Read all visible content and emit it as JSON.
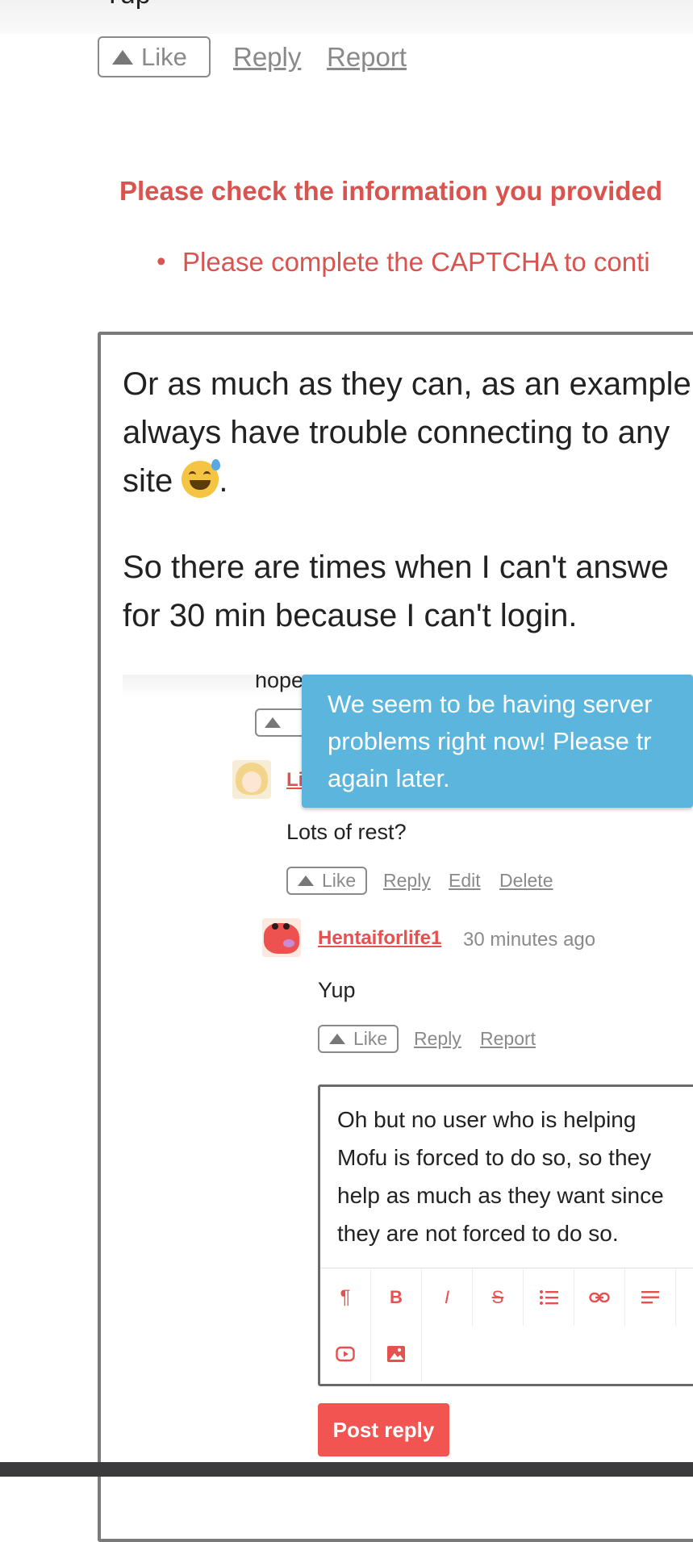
{
  "prev_comment": {
    "cut_text": "Yup",
    "like_label": "Like",
    "reply_label": "Reply",
    "report_label": "Report"
  },
  "error": {
    "title": "Please check the information you provided",
    "items": [
      "Please complete the CAPTCHA to conti"
    ]
  },
  "editor": {
    "paragraphs": [
      [
        "Or as much as they can, as an example",
        "always have trouble connecting to any",
        "site"
      ],
      [
        "So there are times when I can't answe",
        "for 30 min because I can't login."
      ]
    ],
    "emoji": "sweat-smile-emoji"
  },
  "embed": {
    "cut_text": "hope",
    "toast": [
      "We seem to be having server",
      "problems right now! Please tr",
      "again later."
    ],
    "comment1": {
      "author_cut": "Li",
      "body": "Lots of rest?",
      "like_label": "Like",
      "actions": [
        "Reply",
        "Edit",
        "Delete"
      ]
    },
    "comment2": {
      "author": "Hentaiforlife1",
      "time": "30 minutes ago",
      "body": "Yup",
      "like_label": "Like",
      "actions": [
        "Reply",
        "Report"
      ]
    },
    "reply_box": {
      "lines": [
        "Oh but no user who is helping",
        "Mofu is forced to do so, so they",
        "help as much as they want since",
        "they are not forced to do so."
      ],
      "toolbar": [
        "paragraph-icon",
        "bold-icon",
        "italic-icon",
        "strikethrough-icon",
        "list-icon",
        "link-icon",
        "align-icon",
        "video-icon",
        "image-icon"
      ]
    },
    "post_button": "Post reply"
  },
  "colors": {
    "accent": "#e4514f",
    "error": "#d9534f",
    "toast": "#5bb5dc",
    "button": "#f25452"
  }
}
